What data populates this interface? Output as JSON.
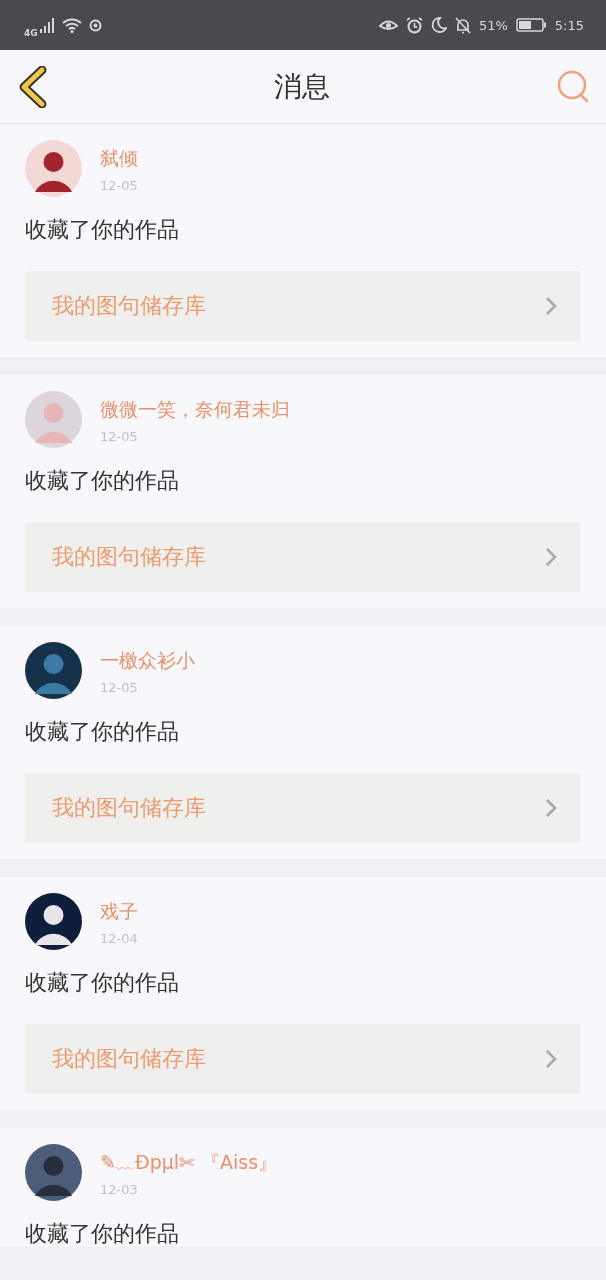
{
  "status_bar": {
    "network": "4G",
    "battery": "51%",
    "time": "5:15"
  },
  "header": {
    "title": "消息"
  },
  "messages": [
    {
      "name": "弑倾",
      "date": "12-05",
      "action": "收藏了你的作品",
      "link": "我的图句储存库"
    },
    {
      "name": "微微一笑，奈何君未归",
      "date": "12-05",
      "action": "收藏了你的作品",
      "link": "我的图句储存库"
    },
    {
      "name": "一檄众衫小",
      "date": "12-05",
      "action": "收藏了你的作品",
      "link": "我的图句储存库"
    },
    {
      "name": "戏子",
      "date": "12-04",
      "action": "收藏了你的作品",
      "link": "我的图句储存库"
    },
    {
      "name": "✎﹏Ðpμl✄ 『Aiss』",
      "date": "12-03",
      "action": "收藏了你的作品"
    }
  ]
}
